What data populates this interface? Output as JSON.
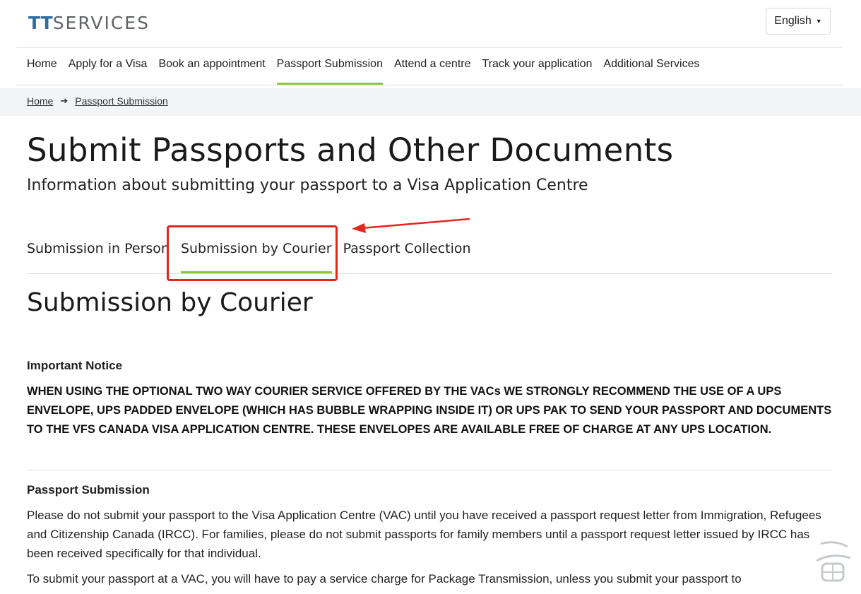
{
  "brand": {
    "logo_tt": "TT",
    "logo_rest": "SERVICES"
  },
  "language": {
    "label": "English"
  },
  "nav": {
    "items": [
      {
        "label": "Home",
        "active": false
      },
      {
        "label": "Apply for a Visa",
        "active": false
      },
      {
        "label": "Book an appointment",
        "active": false
      },
      {
        "label": "Passport Submission",
        "active": true
      },
      {
        "label": "Attend a centre",
        "active": false
      },
      {
        "label": "Track your application",
        "active": false
      },
      {
        "label": "Additional Services",
        "active": false
      }
    ]
  },
  "breadcrumb": {
    "home": "Home",
    "current": "Passport Submission"
  },
  "page": {
    "title": "Submit Passports and Other Documents",
    "subtitle": "Information about submitting your passport to a Visa Application Centre"
  },
  "tabs": [
    {
      "label": "Submission in Person",
      "active": false
    },
    {
      "label": "Submission by Courier",
      "active": true
    },
    {
      "label": "Passport Collection",
      "active": false
    }
  ],
  "section": {
    "heading": "Submission by Courier",
    "notice_heading": "Important Notice",
    "notice_text": "WHEN USING THE OPTIONAL TWO WAY COURIER SERVICE OFFERED BY THE VACs WE STRONGLY RECOMMEND THE USE OF A UPS ENVELOPE, UPS PADDED ENVELOPE (WHICH HAS BUBBLE WRAPPING INSIDE IT) OR UPS PAK TO SEND YOUR PASSPORT AND DOCUMENTS TO THE VFS CANADA VISA APPLICATION CENTRE. THESE ENVELOPES ARE AVAILABLE FREE OF CHARGE AT ANY UPS LOCATION.",
    "submission_heading": "Passport Submission",
    "paragraph1": "Please do not submit your passport to the Visa Application Centre (VAC) until you have received a passport request letter from Immigration, Refugees and Citizenship Canada (IRCC). For families, please do not submit passports for family members until a passport request letter issued by IRCC has been received specifically for that individual.",
    "paragraph2": "To submit your passport at a VAC, you will have to pay a service charge for Package Transmission, unless you submit your passport to"
  },
  "colors": {
    "accent_green": "#8dc63f",
    "annotation_red": "#e5231f",
    "logo_blue": "#2e6da4"
  }
}
